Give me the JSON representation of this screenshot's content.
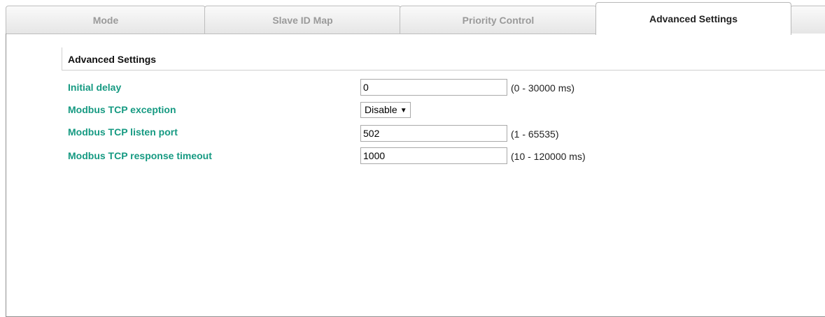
{
  "tabs": [
    {
      "label": "Mode",
      "active": false
    },
    {
      "label": "Slave ID Map",
      "active": false
    },
    {
      "label": "Priority Control",
      "active": false
    },
    {
      "label": "Advanced Settings",
      "active": true
    },
    {
      "label": "",
      "active": false
    }
  ],
  "section": {
    "title": "Advanced Settings"
  },
  "fields": {
    "initial_delay": {
      "label": "Initial delay",
      "value": "0",
      "range": "(0 - 30000 ms)"
    },
    "tcp_exception": {
      "label": "Modbus TCP exception",
      "selected": "Disable",
      "arrow": "▼"
    },
    "listen_port": {
      "label": "Modbus TCP listen port",
      "value": "502",
      "range": "(1 - 65535)"
    },
    "response_timeout": {
      "label": "Modbus TCP response timeout",
      "value": "1000",
      "range": "(10 - 120000 ms)"
    }
  },
  "colors": {
    "label_green": "#169a82",
    "tab_inactive_text": "#9a9a9a",
    "tab_active_text": "#222222"
  }
}
